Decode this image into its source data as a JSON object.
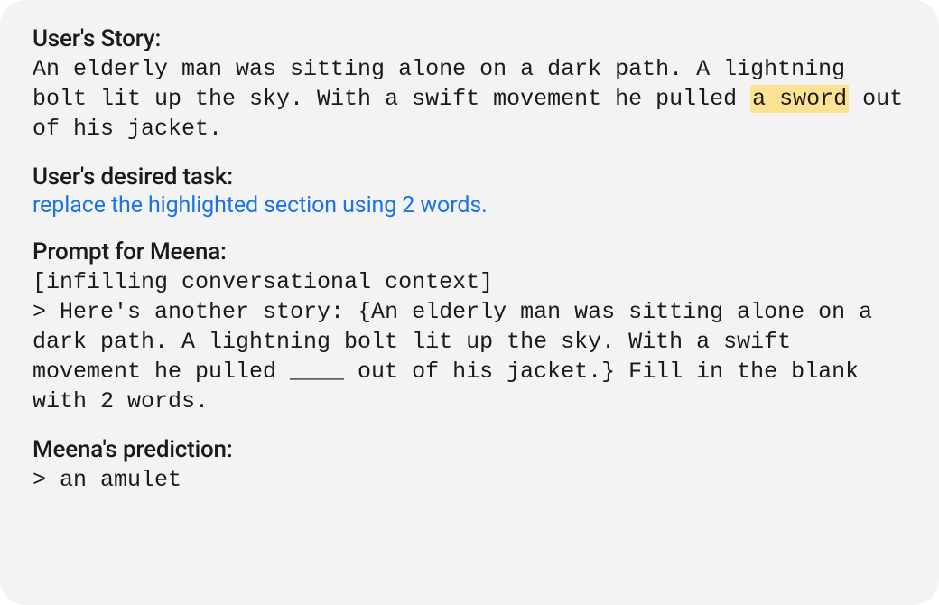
{
  "sections": {
    "story": {
      "heading": "User's Story:",
      "pre": "An elderly man was sitting alone on a dark path. A lightning bolt lit up the sky. With a swift movement he pulled ",
      "highlighted": "a sword",
      "post": " out of his jacket."
    },
    "task": {
      "heading": "User's desired task:",
      "text": "replace the highlighted section using 2 words."
    },
    "prompt": {
      "heading": "Prompt for Meena:",
      "text": "[infilling conversational context]\n> Here's another story: {An elderly man was sitting alone on a dark path. A lightning bolt lit up the sky. With a swift movement he pulled ____ out of his jacket.} Fill in the blank with 2 words."
    },
    "prediction": {
      "heading": "Meena's prediction:",
      "text": "> an amulet"
    }
  }
}
